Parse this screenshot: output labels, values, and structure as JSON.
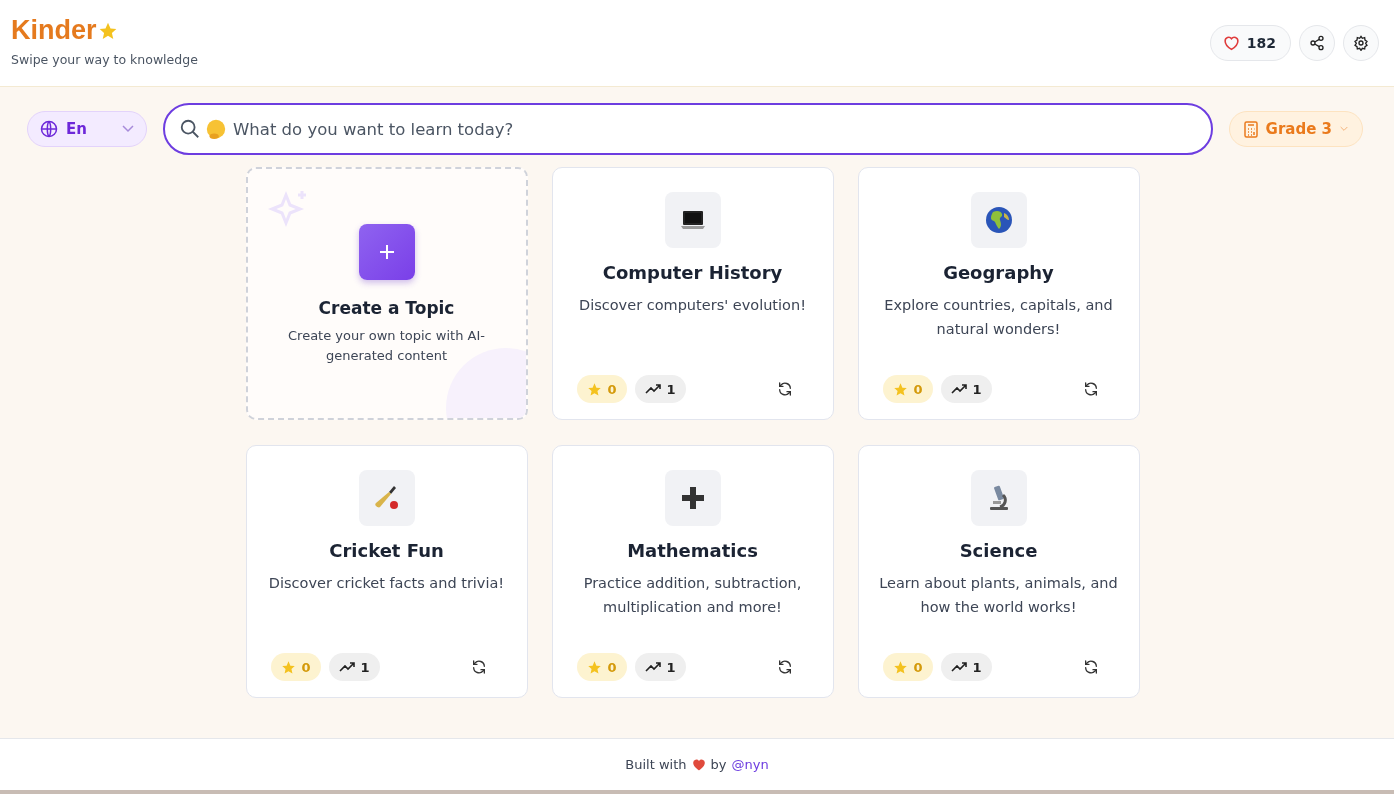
{
  "header": {
    "logo": "Kinder",
    "tagline": "Swipe your way to knowledge",
    "likes": "182"
  },
  "toolbar": {
    "language": "En",
    "search": {
      "placeholder": "What do you want to learn today?"
    },
    "grade": "Grade 3"
  },
  "cards": [
    {
      "kind": "create",
      "title": "Create a Topic",
      "description": "Create your own topic with AI-generated content"
    },
    {
      "kind": "topic",
      "title": "Computer History",
      "description": "Discover computers' evolution!",
      "stars_count": "0",
      "trend": "1"
    },
    {
      "kind": "topic",
      "title": "Geography",
      "description": "Explore countries, capitals, and natural wonders!",
      "stars_count": "0",
      "trend": "1"
    },
    {
      "kind": "topic",
      "title": "Cricket Fun",
      "description": "Discover cricket facts and trivia!",
      "stars_count": "0",
      "trend": "1"
    },
    {
      "kind": "topic",
      "title": "Mathematics",
      "description": "Practice addition, subtraction, multiplication and more!",
      "stars_count": "0",
      "trend": "1"
    },
    {
      "kind": "topic",
      "title": "Science",
      "description": "Learn about plants, animals, and how the world works!",
      "stars_count": "0",
      "trend": "1"
    }
  ],
  "footer": {
    "before": "Built with",
    "after": "by",
    "link": "@nyn"
  }
}
